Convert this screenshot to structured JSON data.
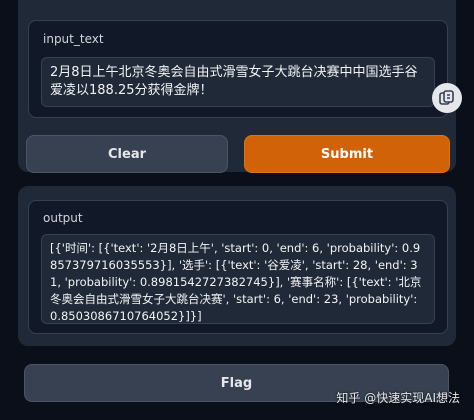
{
  "input": {
    "label": "input_text",
    "value": "2月8日上午北京冬奥会自由式滑雪女子大跳台决赛中中国选手谷爱凌以188.25分获得金牌！"
  },
  "buttons": {
    "clear": "Clear",
    "submit": "Submit",
    "flag": "Flag"
  },
  "output": {
    "label": "output",
    "value": "[{'时间': [{'text': '2月8日上午', 'start': 0, 'end': 6, 'probability': 0.9857379716035553}], '选手': [{'text': '谷爱凌', 'start': 28, 'end': 31, 'probability': 0.8981542727382745}], '赛事名称': [{'text': '北京冬奥会自由式滑雪女子大跳台决赛', 'start': 6, 'end': 23, 'probability': 0.8503086710764052}]}]"
  },
  "watermark": {
    "text": "知乎 @快速实现AI想法"
  },
  "colors": {
    "background": "#0b0f19",
    "panel": "#1f2937",
    "submit": "#d26208"
  },
  "icons": {
    "copy": "copy-icon"
  }
}
